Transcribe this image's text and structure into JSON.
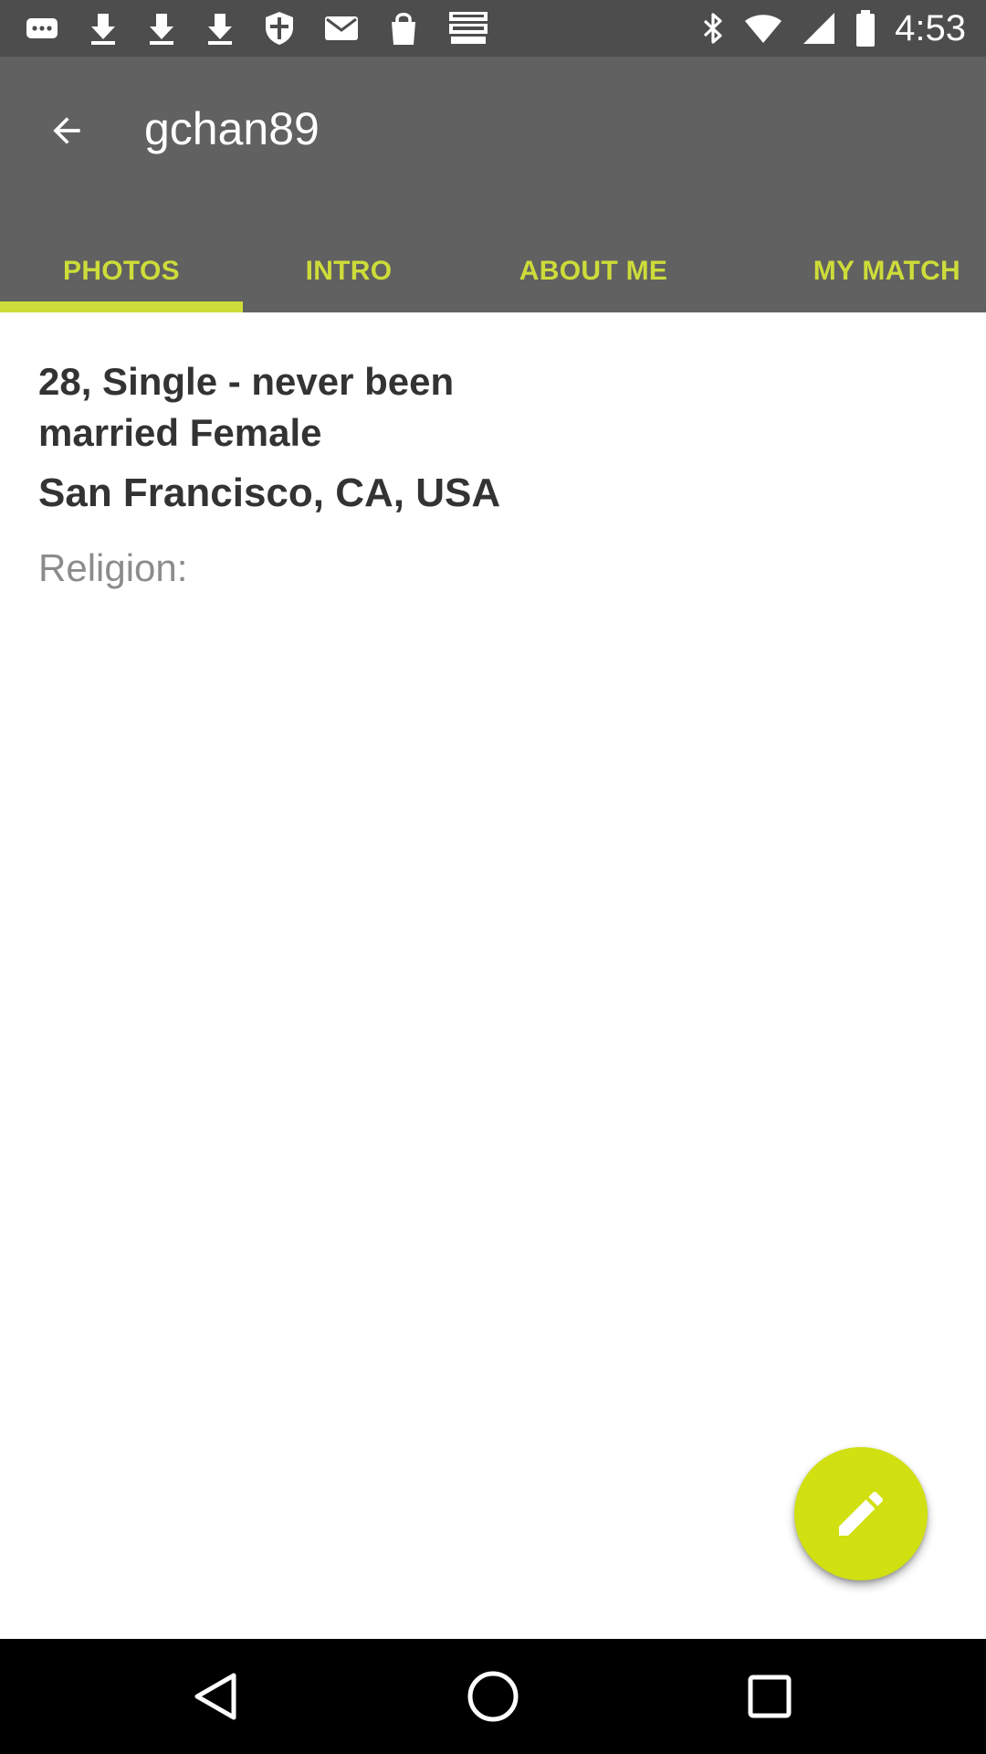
{
  "status_bar": {
    "time": "4:53",
    "left_icons": [
      "more-icon",
      "download-icon",
      "download-icon",
      "download-icon",
      "shield-icon",
      "mail-icon",
      "shopping-bag-icon",
      "espn-dallas-icon"
    ],
    "right_icons": [
      "bluetooth-icon",
      "wifi-icon",
      "cellular-icon",
      "battery-icon"
    ]
  },
  "header": {
    "title": "gchan89",
    "back_icon": "arrow-back-icon"
  },
  "tabs": [
    {
      "label": "PHOTOS",
      "selected": true
    },
    {
      "label": "INTRO",
      "selected": false
    },
    {
      "label": "ABOUT ME",
      "selected": false
    },
    {
      "label": "MY MATCH",
      "selected": false
    }
  ],
  "profile": {
    "summary": "28, Single - never been married Female",
    "location": "San Francisco, CA, USA",
    "religion_label": "Religion:"
  },
  "fab": {
    "icon": "pencil-icon"
  },
  "nav_bar": {
    "icons": [
      "back-triangle-icon",
      "home-circle-icon",
      "recents-square-icon"
    ]
  },
  "colors": {
    "status_bar": "#4d4d4d",
    "app_bar": "#616161",
    "accent": "#cddc39",
    "fab": "#d0e011",
    "nav_bar": "#000000",
    "text_primary": "#333333",
    "text_secondary": "#8c8c8c"
  }
}
